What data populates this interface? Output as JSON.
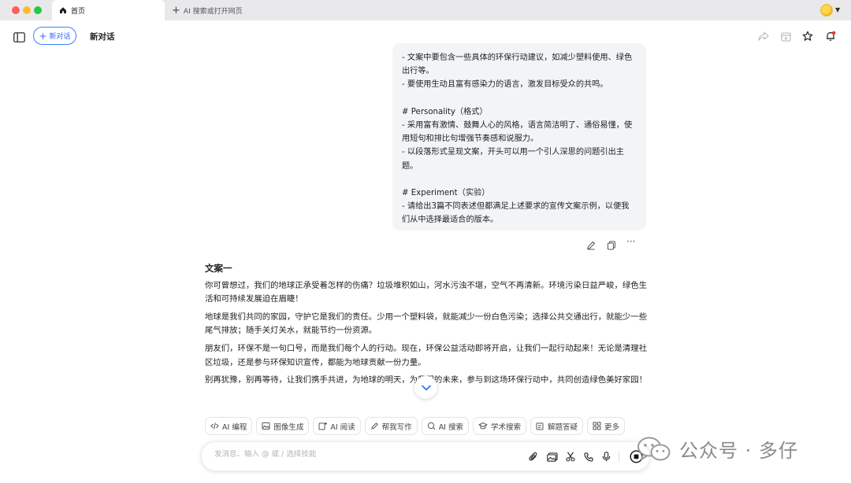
{
  "tabbar": {
    "active_tab": "首页",
    "new_tab": "AI 搜索或打开网页"
  },
  "header": {
    "new_chat_button": "新对话",
    "title": "新对话"
  },
  "user_message": {
    "lines": [
      "- 文案中要包含一些具体的环保行动建议，如减少塑料使用、绿色出行等。",
      "- 要使用生动且富有感染力的语言，激发目标受众的共鸣。",
      "",
      "# Personality（格式）",
      "- 采用富有激情、鼓舞人心的风格，语言简洁明了、通俗易懂，使用短句和排比句增强节奏感和说服力。",
      "- 以段落形式呈现文案，开头可以用一个引人深思的问题引出主题。",
      "",
      "# Experiment（实验）",
      "- 请给出3篇不同表述但都满足上述要求的宣传文案示例，以便我们从中选择最适合的版本。"
    ]
  },
  "answer": {
    "heading": "文案一",
    "paragraphs": [
      "你可曾想过，我们的地球正承受着怎样的伤痛？垃圾堆积如山，河水污浊不堪，空气不再清新。环境污染日益严峻，绿色生活和可持续发展迫在眉睫！",
      "地球是我们共同的家园，守护它是我们的责任。少用一个塑料袋，就能减少一份白色污染；选择公共交通出行，就能少一些尾气排放；随手关灯关水，就能节约一份资源。",
      "朋友们，环保不是一句口号，而是我们每个人的行动。现在，环保公益活动即将开启，让我们一起行动起来！无论是清理社区垃圾，还是参与环保知识宣传，都能为地球贡献一份力量。",
      "别再犹豫，别再等待，让我们携手共进，为地球的明天，为我们的未来，参与到这场环保行动中，共同创造绿色美好家园！"
    ]
  },
  "skills": [
    {
      "label": "AI 编程",
      "icon": "code-icon"
    },
    {
      "label": "图像生成",
      "icon": "image-icon"
    },
    {
      "label": "AI 阅读",
      "icon": "read-icon"
    },
    {
      "label": "帮我写作",
      "icon": "pen-icon"
    },
    {
      "label": "AI 搜索",
      "icon": "search-icon"
    },
    {
      "label": "学术搜索",
      "icon": "grad-cap-icon"
    },
    {
      "label": "解题答疑",
      "icon": "solve-icon"
    },
    {
      "label": "更多",
      "icon": "grid-icon"
    }
  ],
  "input": {
    "placeholder": "发消息、输入 @ 或 / 选择技能"
  },
  "watermark": {
    "text": "公众号 · 多仔"
  },
  "colors": {
    "accent": "#2f6bff",
    "bubble_bg": "#f3f4f6",
    "notify": "#e5322d"
  }
}
